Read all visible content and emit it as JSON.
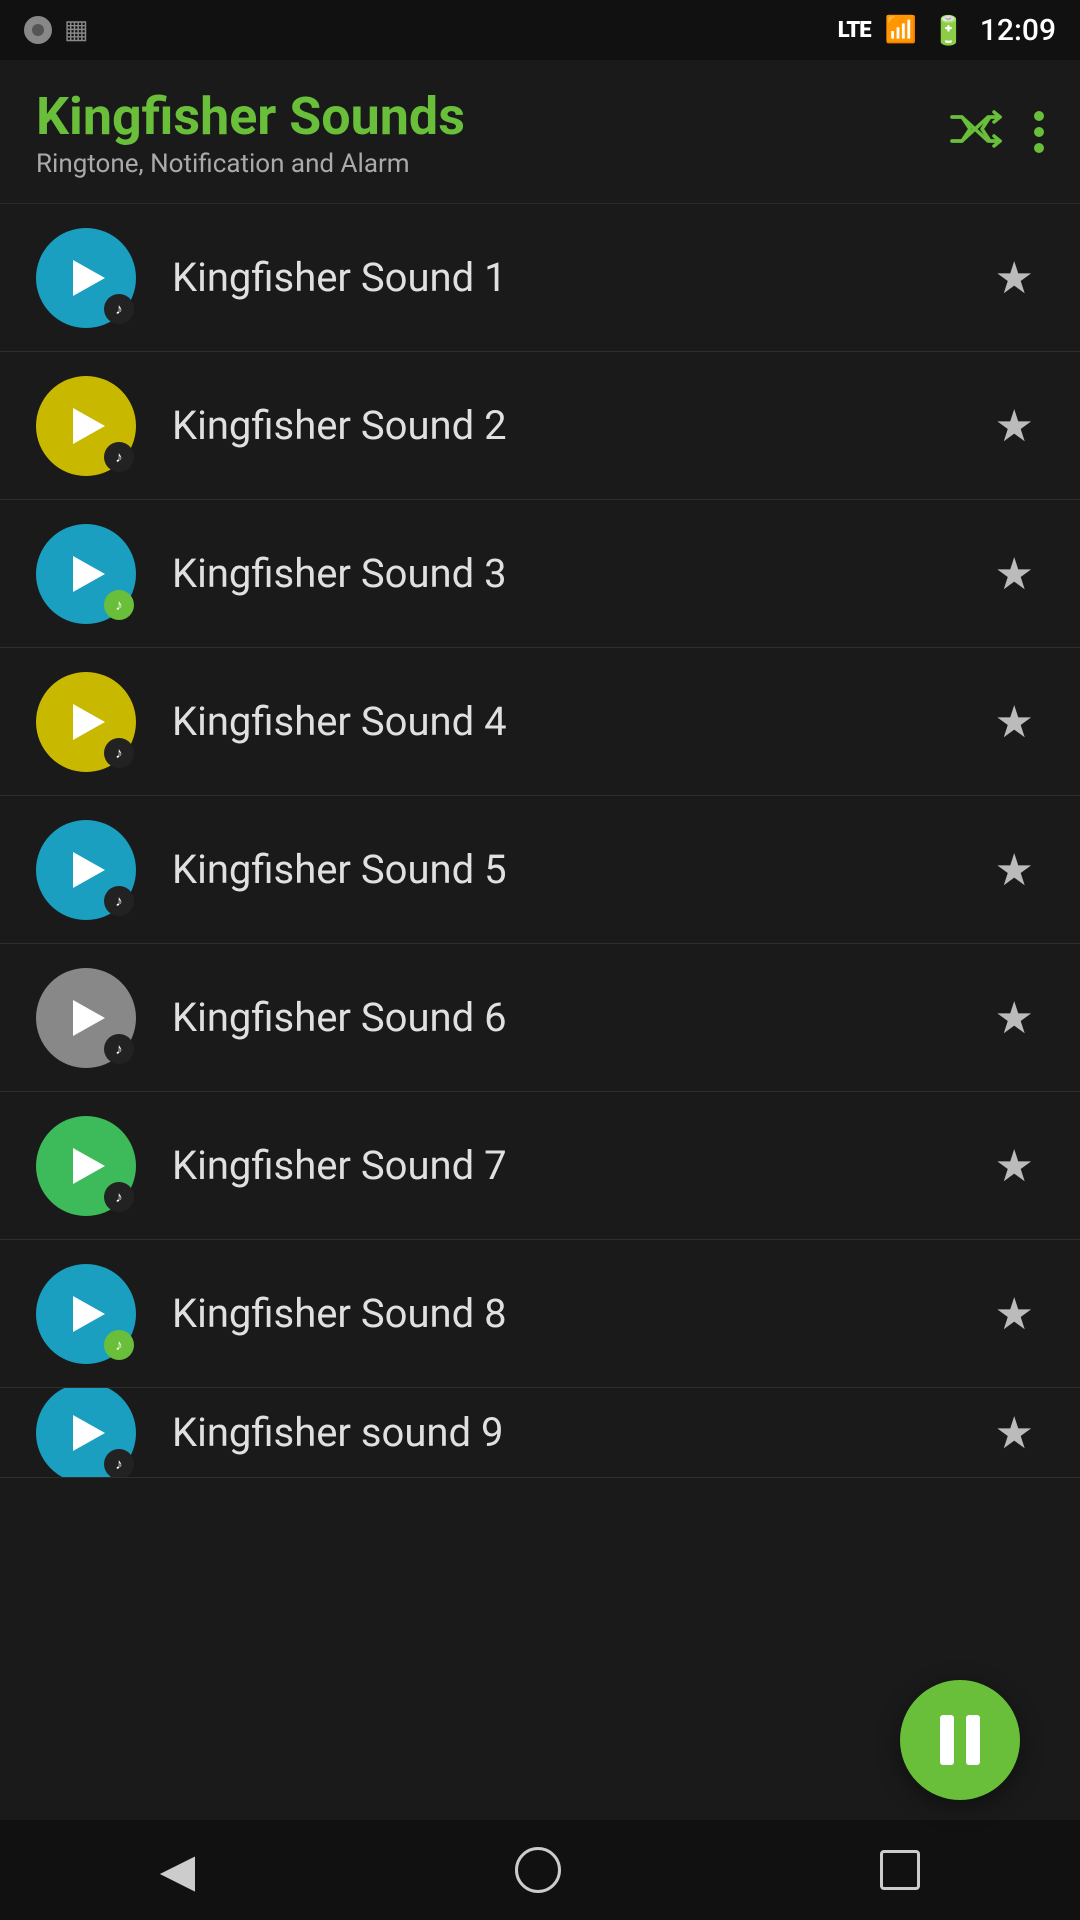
{
  "statusBar": {
    "time": "12:09",
    "lte": "LTE"
  },
  "header": {
    "title": "Kingfisher Sounds",
    "subtitle": "Ringtone, Notification and Alarm",
    "shuffleLabel": "shuffle",
    "moreLabel": "more"
  },
  "sounds": [
    {
      "id": 1,
      "name": "Kingfisher Sound 1",
      "color": "blue",
      "badgeColor": "dark",
      "starred": false
    },
    {
      "id": 2,
      "name": "Kingfisher Sound 2",
      "color": "yellow",
      "badgeColor": "dark",
      "starred": false
    },
    {
      "id": 3,
      "name": "Kingfisher Sound 3",
      "color": "teal",
      "badgeColor": "green",
      "starred": false
    },
    {
      "id": 4,
      "name": "Kingfisher Sound 4",
      "color": "yellow",
      "badgeColor": "dark",
      "starred": false
    },
    {
      "id": 5,
      "name": "Kingfisher Sound 5",
      "color": "teal",
      "badgeColor": "dark",
      "starred": false
    },
    {
      "id": 6,
      "name": "Kingfisher Sound 6",
      "color": "gray",
      "badgeColor": "dark",
      "starred": false
    },
    {
      "id": 7,
      "name": "Kingfisher Sound 7",
      "color": "green",
      "badgeColor": "dark",
      "starred": false
    },
    {
      "id": 8,
      "name": "Kingfisher Sound 8",
      "color": "teal",
      "badgeColor": "green",
      "starred": false
    },
    {
      "id": 9,
      "name": "Kingfisher sound 9",
      "color": "teal",
      "badgeColor": "dark",
      "starred": false
    }
  ],
  "floatingPause": {
    "label": "pause"
  },
  "bottomNav": {
    "back": "◀",
    "home": "",
    "recents": ""
  }
}
